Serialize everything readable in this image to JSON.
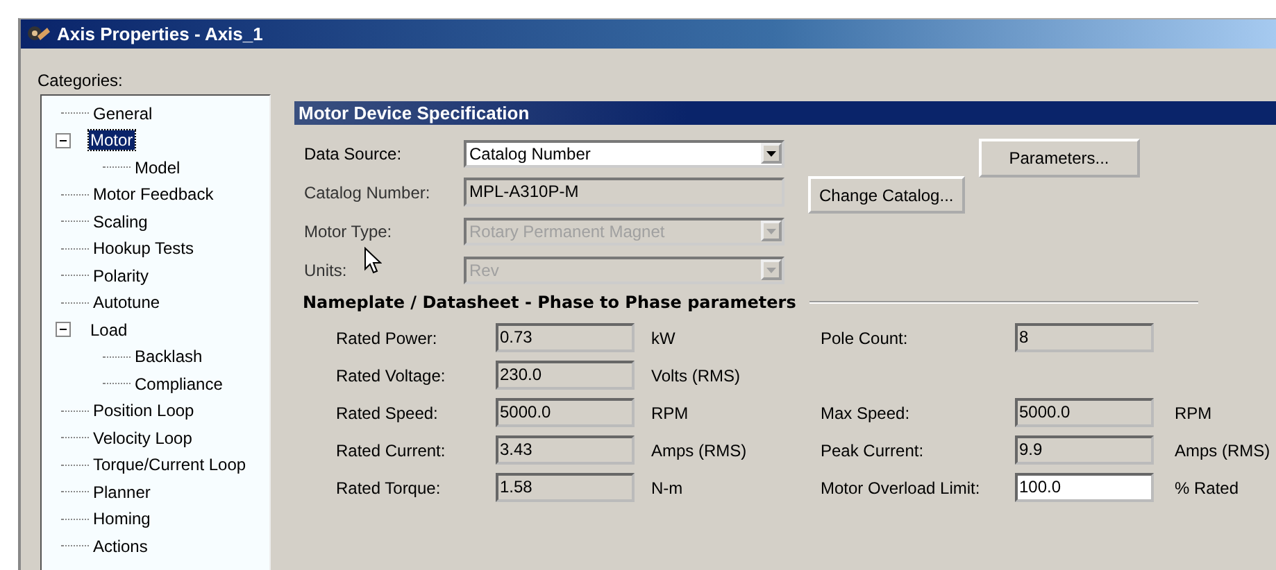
{
  "window": {
    "title": "Axis Properties - Axis_1"
  },
  "categories": {
    "label": "Categories:",
    "items": [
      {
        "label": "General",
        "selected": false
      },
      {
        "label": "Motor",
        "selected": true,
        "expanded": true,
        "children": [
          {
            "label": "Model",
            "selected": false
          }
        ]
      },
      {
        "label": "Motor Feedback",
        "selected": false
      },
      {
        "label": "Scaling",
        "selected": false
      },
      {
        "label": "Hookup Tests",
        "selected": false
      },
      {
        "label": "Polarity",
        "selected": false
      },
      {
        "label": "Autotune",
        "selected": false
      },
      {
        "label": "Load",
        "selected": false,
        "expanded": true,
        "children": [
          {
            "label": "Backlash",
            "selected": false
          },
          {
            "label": "Compliance",
            "selected": false
          }
        ]
      },
      {
        "label": "Position Loop",
        "selected": false
      },
      {
        "label": "Velocity Loop",
        "selected": false
      },
      {
        "label": "Torque/Current Loop",
        "selected": false
      },
      {
        "label": "Planner",
        "selected": false
      },
      {
        "label": "Homing",
        "selected": false
      },
      {
        "label": "Actions",
        "selected": false
      }
    ]
  },
  "section_title": "Motor Device Specification",
  "fields": [
    {
      "kind": "combo",
      "label": "Data Source:",
      "value": "Catalog Number",
      "disabled": false
    },
    {
      "kind": "text",
      "label": "Catalog Number:",
      "value": "MPL-A310P-M",
      "disabled": true
    },
    {
      "kind": "combo",
      "label": "Motor Type:",
      "value": "Rotary Permanent Magnet",
      "disabled": true
    },
    {
      "kind": "combo",
      "label": "Units:",
      "value": "Rev",
      "disabled": true
    }
  ],
  "buttons": {
    "parameters": "Parameters...",
    "change_catalog": "Change Catalog..."
  },
  "nameplate": {
    "title": "Nameplate / Datasheet - Phase to Phase parameters",
    "rows": [
      {
        "left": {
          "label": "Rated Power:",
          "value": "0.73",
          "unit": "kW",
          "editable": false
        },
        "right": {
          "label": "Pole Count:",
          "value": "8",
          "editable": false
        }
      },
      {
        "left": {
          "label": "Rated Voltage:",
          "value": "230.0",
          "unit": "Volts (RMS)",
          "editable": false
        }
      },
      {
        "left": {
          "label": "Rated Speed:",
          "value": "5000.0",
          "unit": "RPM",
          "editable": false
        },
        "right": {
          "label": "Max Speed:",
          "value": "5000.0",
          "unit": "RPM",
          "editable": false
        }
      },
      {
        "left": {
          "label": "Rated Current:",
          "value": "3.43",
          "unit": "Amps (RMS)",
          "editable": false
        },
        "right": {
          "label": "Peak Current:",
          "value": "9.9",
          "unit": "Amps (RMS)",
          "editable": false
        }
      },
      {
        "left": {
          "label": "Rated Torque:",
          "value": "1.58",
          "unit": "N-m",
          "editable": false
        },
        "right": {
          "label": "Motor Overload Limit:",
          "value": "100.0",
          "unit": "% Rated",
          "editable": true
        }
      }
    ]
  }
}
